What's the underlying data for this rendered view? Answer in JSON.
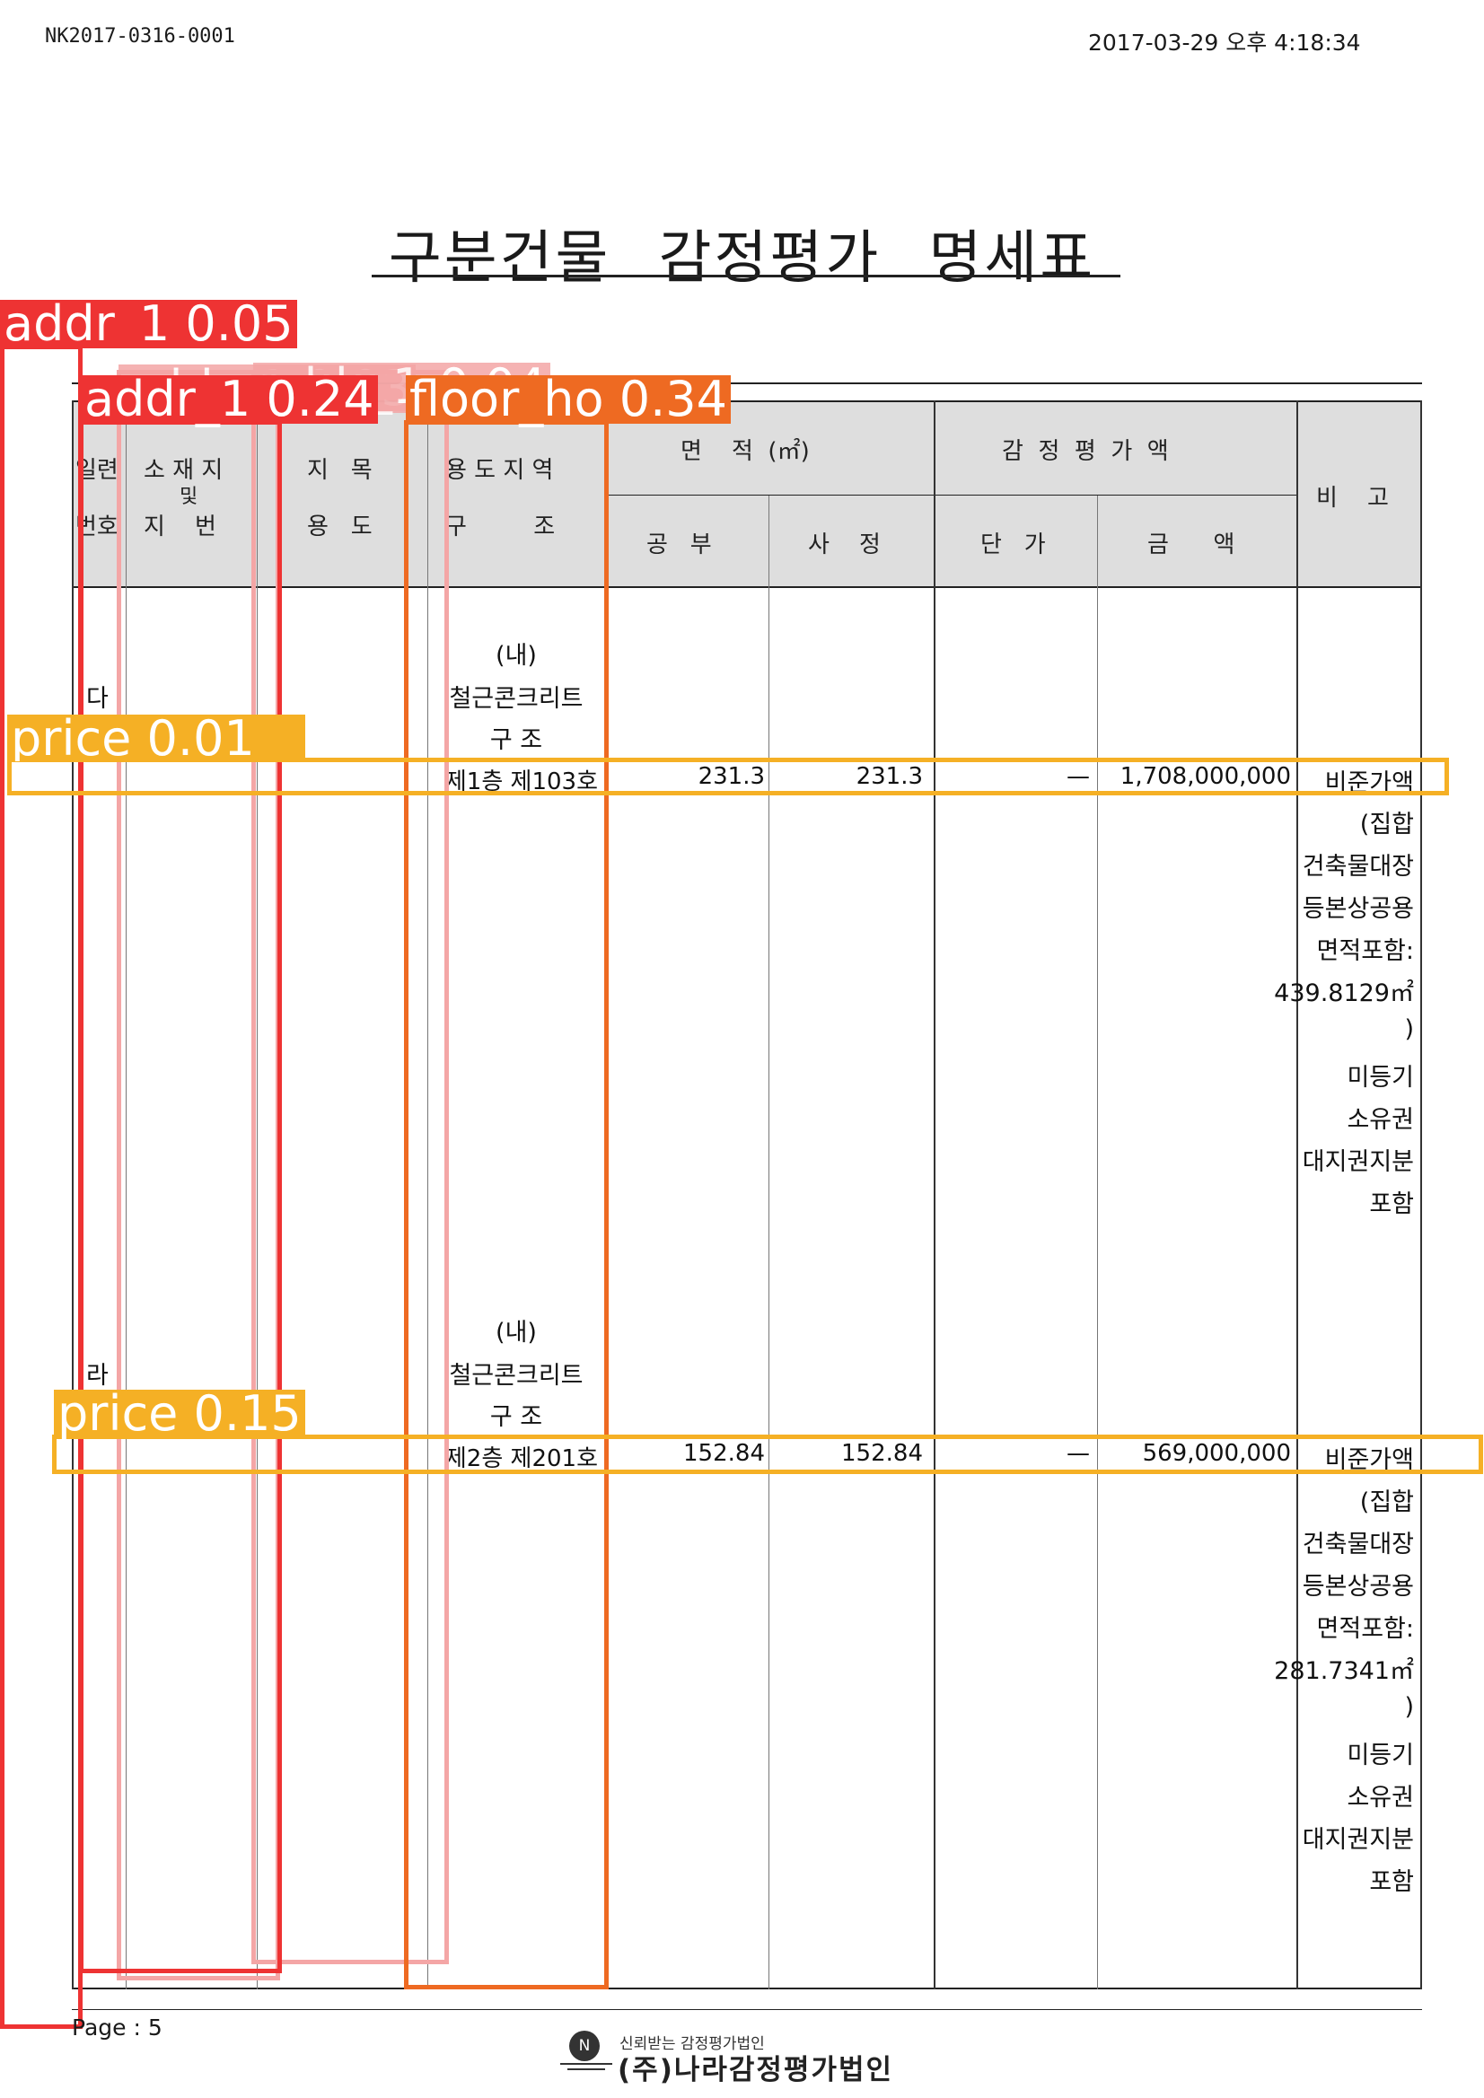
{
  "doc_id": "NK2017-0316-0001",
  "timestamp": "2017-03-29 오후 4:18:34",
  "title": "구분건물   감정평가 명세표",
  "header": {
    "serial_top": "일련",
    "serial_bottom": "번호",
    "location_top": "소 재 지",
    "location_mid": "및",
    "location_bottom": "지    번",
    "category_top": "지   목",
    "category_bottom": "용   도",
    "zone_top": "용 도 지 역",
    "zone_bottom": "구         조",
    "area_group": "면    적  (㎡)",
    "area_public": "공   부",
    "area_assessed": "사    정",
    "value_group": "감  정  평  가  액",
    "unit_price": "단   가",
    "amount": "금      액",
    "remarks": "비    고"
  },
  "rows": [
    {
      "serial": "다",
      "structure_l1": "(내)",
      "structure_l2": "철근콘크리트",
      "structure_l3": "구 조",
      "floor_unit": "제1층 제103호",
      "area_public": "231.3",
      "area_assessed": "231.3",
      "unit_price": "—",
      "amount": "1,708,000,000",
      "remarks": [
        "비준가액",
        "(집합",
        "건축물대장",
        "등본상공용",
        "면적포함:",
        "439.8129㎡",
        ")",
        "미등기",
        "소유권",
        "대지권지분",
        "포함"
      ]
    },
    {
      "serial": "라",
      "structure_l1": "(내)",
      "structure_l2": "철근콘크리트",
      "structure_l3": "구 조",
      "floor_unit": "제2층 제201호",
      "area_public": "152.84",
      "area_assessed": "152.84",
      "unit_price": "—",
      "amount": "569,000,000",
      "remarks": [
        "비준가액",
        "(집합",
        "건축물대장",
        "등본상공용",
        "면적포함:",
        "281.7341㎡",
        ")",
        "미등기",
        "소유권",
        "대지권지분",
        "포함"
      ]
    }
  ],
  "detections": [
    {
      "label": "addr_1 0.05",
      "color": "#ee3333"
    },
    {
      "label": "addr_1 0.24",
      "color": "#ee3333"
    },
    {
      "label": "floor_ho 0.34",
      "color": "#ee6a22"
    },
    {
      "label": "price 0.01",
      "color": "#f5b025"
    },
    {
      "label": "price 0.15",
      "color": "#f5b025"
    },
    {
      "label": "addr_1 0.03",
      "color": "#f4a6a6"
    },
    {
      "label": "addr_1 0.04",
      "color": "#f4a6a6"
    }
  ],
  "footer": {
    "page": "Page  :  5",
    "logo_letter": "N",
    "brand_slogan": "신뢰받는 감정평가법인",
    "brand_name": "(주)나라감정평가법인"
  }
}
